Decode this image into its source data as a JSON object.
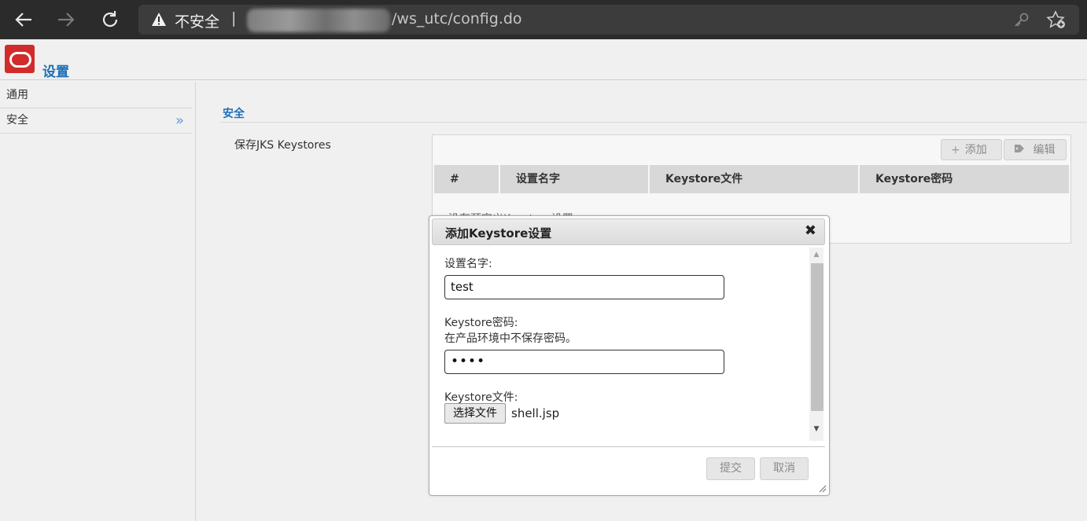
{
  "browser": {
    "security_label": "不安全",
    "url_visible": "/ws_utc/config.do",
    "icons": [
      "back-arrow-icon",
      "forward-arrow-icon",
      "reload-icon",
      "warning-icon",
      "key-icon",
      "favorite-star-icon"
    ]
  },
  "header": {
    "title": "设置"
  },
  "sidebar": {
    "items": [
      {
        "label": "通用"
      },
      {
        "label": "安全",
        "chevron": "»"
      }
    ]
  },
  "main": {
    "section_title": "安全",
    "keystores_label": "保存JKS Keystores",
    "toolbar": {
      "add": "添加",
      "edit": "编辑"
    },
    "table": {
      "columns": [
        "#",
        "设置名字",
        "Keystore文件",
        "Keystore密码"
      ],
      "empty_text": "没有预定义Keystore设置"
    }
  },
  "dialog": {
    "title": "添加Keystore设置",
    "close": "✖",
    "name_label": "设置名字:",
    "name_value": "test",
    "password_label": "Keystore密码:",
    "password_hint": "在产品环境中不保存密码。",
    "password_value": "••••",
    "file_label": "Keystore文件:",
    "file_button": "选择文件",
    "file_name": "shell.jsp",
    "submit": "提交",
    "cancel": "取消"
  },
  "colors": {
    "accent": "#1f6fb8",
    "logo": "#d22b2b",
    "browser_bar": "#2b2b2b"
  }
}
